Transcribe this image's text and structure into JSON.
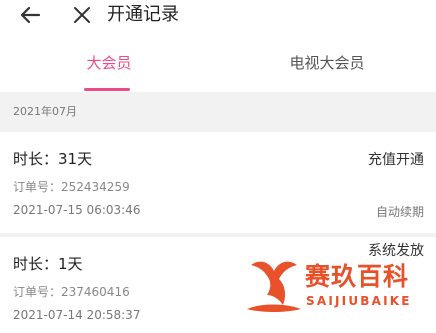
{
  "header": {
    "title": "开通记录"
  },
  "tabs": [
    {
      "label": "大会员",
      "active": true
    },
    {
      "label": "电视大会员",
      "active": false
    }
  ],
  "month": {
    "label": "2021年07月"
  },
  "records": [
    {
      "duration": "时长：31天",
      "type": "充值开通",
      "order": "订单号：252434259",
      "time": "2021-07-15 06:03:46",
      "note": "自动续期"
    },
    {
      "duration": "时长：1天",
      "type": "系统发放",
      "order": "订单号：237460416",
      "time": "2021-07-14 20:58:37",
      "note": ""
    }
  ],
  "watermark": {
    "brand": "赛玖百科",
    "sub": "SAIJIUBAIKE"
  },
  "colors": {
    "accent": "#ee4a89",
    "watermark": "#e8512a",
    "section_bg": "#f2f2f2"
  },
  "icons": {
    "back": "arrow-left-icon",
    "close": "close-icon"
  }
}
